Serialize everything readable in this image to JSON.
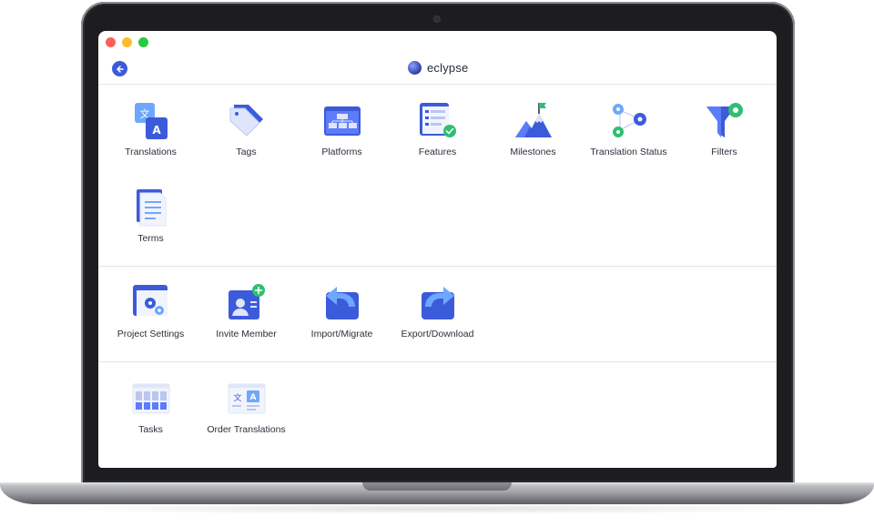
{
  "app": {
    "brand_name": "eclypse",
    "back_label": "back"
  },
  "sections": {
    "main": [
      {
        "label": "Translations",
        "icon": "translate-icon"
      },
      {
        "label": "Tags",
        "icon": "tag-icon"
      },
      {
        "label": "Platforms",
        "icon": "platforms-icon"
      },
      {
        "label": "Features",
        "icon": "features-icon"
      },
      {
        "label": "Milestones",
        "icon": "milestone-icon"
      },
      {
        "label": "Translation Status",
        "icon": "gears-icon"
      },
      {
        "label": "Filters",
        "icon": "filter-icon"
      },
      {
        "label": "Terms",
        "icon": "document-icon"
      }
    ],
    "project": [
      {
        "label": "Project Settings",
        "icon": "settings-icon"
      },
      {
        "label": "Invite Member",
        "icon": "invite-member-icon"
      },
      {
        "label": "Import/Migrate",
        "icon": "import-icon"
      },
      {
        "label": "Export/Download",
        "icon": "export-icon"
      }
    ],
    "extras": [
      {
        "label": "Tasks",
        "icon": "tasks-icon"
      },
      {
        "label": "Order Translations",
        "icon": "order-translations-icon"
      }
    ]
  },
  "colors": {
    "primary": "#3b5bdb",
    "accent_green": "#2fbf71",
    "light_blue": "#6ea8fe"
  }
}
